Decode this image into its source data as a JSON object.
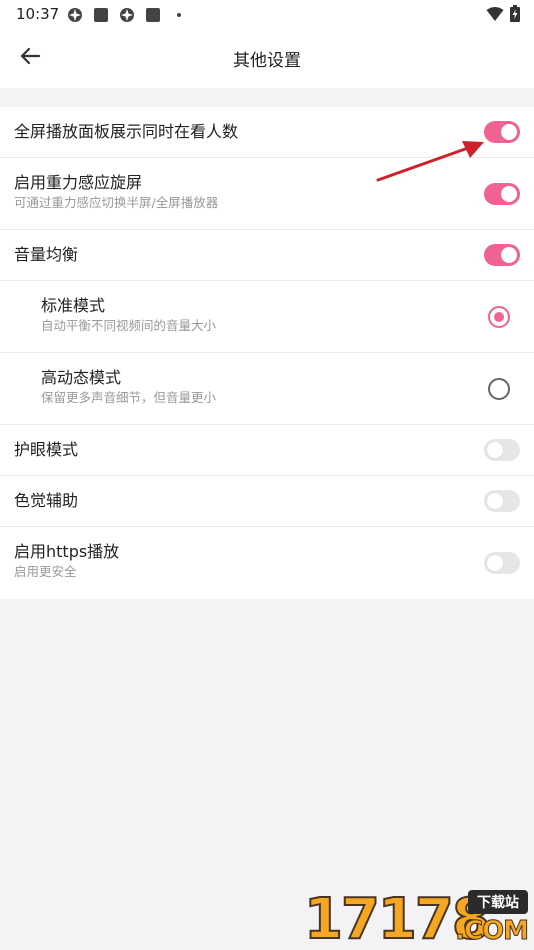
{
  "status_bar": {
    "time": "10:37",
    "icons": [
      "app-notification-icon",
      "square-notification-icon",
      "app-notification-icon",
      "square-notification-icon",
      "dot-icon"
    ],
    "right_icons": [
      "wifi-icon",
      "battery-charging-icon"
    ]
  },
  "header": {
    "title": "其他设置",
    "back_icon": "arrow-left-icon"
  },
  "settings": [
    {
      "title": "全屏播放面板展示同时在看人数",
      "subtitle": "",
      "control": "switch",
      "state": "on"
    },
    {
      "title": "启用重力感应旋屏",
      "subtitle": "可通过重力感应切换半屏/全屏播放器",
      "control": "switch",
      "state": "on"
    },
    {
      "title": "音量均衡",
      "subtitle": "",
      "control": "switch",
      "state": "on"
    },
    {
      "title": "标准模式",
      "subtitle": "自动平衡不同视频间的音量大小",
      "control": "radio",
      "state": "checked"
    },
    {
      "title": "高动态模式",
      "subtitle": "保留更多声音细节，但音量更小",
      "control": "radio",
      "state": "unchecked"
    },
    {
      "title": "护眼模式",
      "subtitle": "",
      "control": "switch",
      "state": "off"
    },
    {
      "title": "色觉辅助",
      "subtitle": "",
      "control": "switch",
      "state": "off"
    },
    {
      "title": "启用https播放",
      "subtitle": "启用更安全",
      "control": "switch",
      "state": "off"
    }
  ],
  "colors": {
    "accent": "#f06292",
    "switch_off": "#e6e6e6",
    "background": "#f3f3f5",
    "annotation": "#d0202a"
  },
  "watermark": {
    "digits": "17178",
    "badge": "下载站",
    "suffix": ".COM"
  }
}
